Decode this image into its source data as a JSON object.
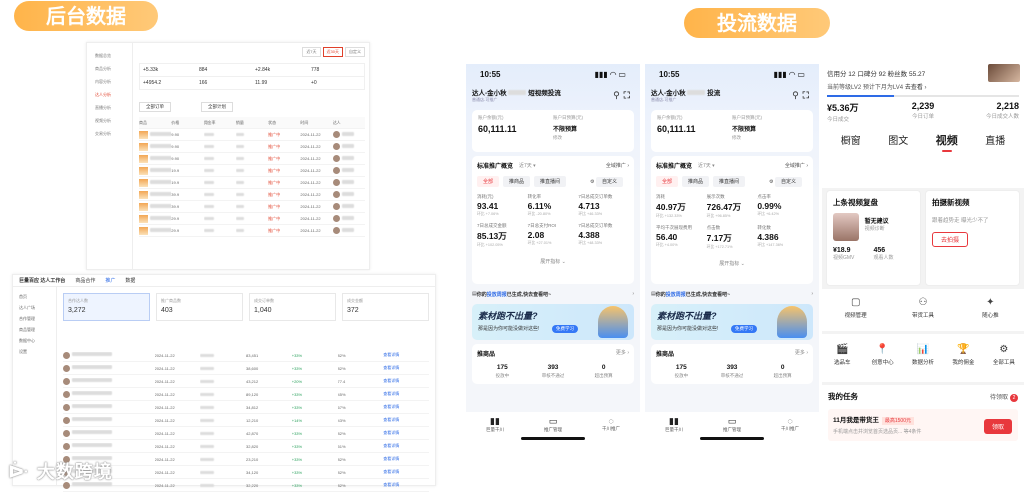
{
  "labels": {
    "backend": "后台数据",
    "ads": "投流数据"
  },
  "backend1": {
    "side_items": [
      "数据总览",
      "商品分析",
      "内容分析",
      "达人分析",
      "直播分析",
      "视频分析",
      "交易分析"
    ],
    "tabs": [
      "近7天",
      "近30天",
      "自定义"
    ],
    "stats": [
      "+5.33k",
      "884",
      "+2.84k",
      "778",
      "+4954.2",
      "166",
      "11.99",
      "+0"
    ],
    "filter1": "全部订单",
    "filter2": "全部计划",
    "headers": [
      "商品",
      "价格",
      "佣金率",
      "销量",
      "状态",
      "时间",
      "达人"
    ],
    "rows": [
      {
        "price": "9.90",
        "status": "推广中",
        "date": "2024-11-22"
      },
      {
        "price": "9.90",
        "status": "推广中",
        "date": "2024-11-22"
      },
      {
        "price": "9.90",
        "status": "推广中",
        "date": "2024-11-22"
      },
      {
        "price": "19.9",
        "status": "推广中",
        "date": "2024-11-22"
      },
      {
        "price": "19.9",
        "status": "推广中",
        "date": "2024-11-22"
      },
      {
        "price": "39.9",
        "status": "推广中",
        "date": "2024-11-22"
      },
      {
        "price": "39.9",
        "status": "推广中",
        "date": "2024-11-22"
      },
      {
        "price": "29.9",
        "status": "推广中",
        "date": "2024-11-22"
      },
      {
        "price": "29.9",
        "status": "推广中",
        "date": "2024-11-22"
      }
    ]
  },
  "backend2": {
    "logo": "巨量百应 达人工作台",
    "top_tabs": [
      "商品合作",
      "推广",
      "数据"
    ],
    "side_items": [
      "首页",
      "达人广场",
      "合作管理",
      "商品管理",
      "数据中心",
      "设置"
    ],
    "cards": [
      {
        "label": "合作达人数",
        "value": "3,272"
      },
      {
        "label": "推广商品数",
        "value": "403"
      },
      {
        "label": "成交订单数",
        "value": "1,040"
      },
      {
        "label": "成交金额",
        "value": "372"
      }
    ],
    "rows": [
      {
        "d": "2024-11-22",
        "v": "83,451",
        "p": "+33%",
        "s": "82%"
      },
      {
        "d": "2024-11-22",
        "v": "38,600",
        "p": "+33%",
        "s": "82%"
      },
      {
        "d": "2024-11-22",
        "v": "43,212",
        "p": "+20%",
        "s": "77.4"
      },
      {
        "d": "2024-11-22",
        "v": "89,120",
        "p": "+33%",
        "s": "45%"
      },
      {
        "d": "2024-11-22",
        "v": "34,812",
        "p": "+33%",
        "s": "67%"
      },
      {
        "d": "2024-11-22",
        "v": "12,210",
        "p": "+14%",
        "s": "43%"
      },
      {
        "d": "2024-11-22",
        "v": "42,870",
        "p": "+33%",
        "s": "82%"
      },
      {
        "d": "2024-11-22",
        "v": "32,820",
        "p": "+33%",
        "s": "51%"
      },
      {
        "d": "2024-11-22",
        "v": "23,210",
        "p": "+33%",
        "s": "82%"
      },
      {
        "d": "2024-11-22",
        "v": "34,120",
        "p": "+33%",
        "s": "82%"
      },
      {
        "d": "2024-11-22",
        "v": "32,220",
        "p": "+33%",
        "s": "82%"
      }
    ],
    "link": "查看详情"
  },
  "phones": {
    "time": "10:55",
    "title1": "达人-金小秋",
    "title1b": "短视频投流",
    "title2": "达人-金小秋",
    "title2b": "投流",
    "subtitle": "普通店-可推广",
    "balance_label": "账户余额(元)",
    "balance": "60,111.11",
    "budget_label": "账户日预算(元)",
    "budget_value": "不限预算",
    "budget_edit": "修改",
    "overview_title": "标准推广概览",
    "period": "近7天",
    "all_ads": "全域推广",
    "chips": [
      "全部",
      "推商品",
      "推直播间"
    ],
    "customize": "自定义",
    "expand": "展开指标",
    "notice_a": "你的",
    "notice_b": "投放周报",
    "notice_c": "已生成,快去查看吧~",
    "banner_title": "素材跑不出量?",
    "banner_sub": "那是因为你可能没做对这些!",
    "banner_btn": "免费学习",
    "rec_title": "推商品",
    "rec_more": "更多",
    "tab_labels": [
      "巨量千川",
      "推广管理",
      "千川推广"
    ]
  },
  "phone1": {
    "metrics": [
      {
        "l": "消耗(元)",
        "v": "93.41",
        "c": "环比 +7.06%"
      },
      {
        "l": "转化率",
        "v": "6.11%",
        "c": "环比 -20.80%"
      },
      {
        "l": "7日总成交订单数",
        "v": "4.713",
        "c": "环比 +46.33%"
      },
      {
        "l": "7日总成交金额",
        "v": "85.13万",
        "c": "环比 +102.05%"
      },
      {
        "l": "7日总支付ROI",
        "v": "2.08",
        "c": "环比 +27.01%"
      },
      {
        "l": "7日总成交订单数",
        "v": "4.388",
        "c": "环比 +48.33%"
      }
    ],
    "rec": [
      {
        "v": "175",
        "l": "投放中"
      },
      {
        "v": "393",
        "l": "审核不通过"
      },
      {
        "v": "0",
        "l": "超出预算"
      }
    ]
  },
  "phone2": {
    "metrics": [
      {
        "l": "消耗",
        "v": "40.97万",
        "c": "环比 +132.33%"
      },
      {
        "l": "展示次数",
        "v": "726.47万",
        "c": "环比 +96.85%"
      },
      {
        "l": "点击率",
        "v": "0.99%",
        "c": "环比 +6.42%"
      },
      {
        "l": "平均千次展现费用",
        "v": "56.40",
        "c": "环比 +4.00%"
      },
      {
        "l": "点击数",
        "v": "7.17万",
        "c": "环比 +172.71%"
      },
      {
        "l": "转化数",
        "v": "4.386",
        "c": "环比 +147.36%"
      }
    ],
    "rec": [
      {
        "v": "175",
        "l": "投放中"
      },
      {
        "v": "393",
        "l": "审核不通过"
      },
      {
        "v": "0",
        "l": "超出预算"
      }
    ]
  },
  "app": {
    "line1": "信用分 12  口碑分 92  粉丝数 55.27",
    "line2a": "当前等级LV2 预计下月为LV4",
    "line2b": "去查看",
    "level_progress": 0.35,
    "stats": [
      {
        "v": "¥5.36万",
        "l": "今日成交"
      },
      {
        "v": "2,239",
        "l": "今日订单"
      },
      {
        "v": "2,218",
        "l": "今日成交人数"
      }
    ],
    "tabs": [
      "橱窗",
      "图文",
      "视频",
      "直播"
    ],
    "active_tab": "视频",
    "review_title": "上条视频复盘",
    "review_name": "暂无建议",
    "review_sub": "视频诊断",
    "gmv_v": "¥18.9",
    "gmv_l": "视频GMV",
    "viewers_v": "456",
    "viewers_l": "观看人数",
    "shoot_title": "拍摄新视频",
    "shoot_desc": "跟着趋势走 曝光少不了",
    "shoot_btn": "去拍摄",
    "tools": [
      {
        "i": "▢",
        "l": "视频管理"
      },
      {
        "i": "⚇",
        "l": "带货工具"
      },
      {
        "i": "✦",
        "l": "随心推"
      }
    ],
    "tools2": [
      {
        "i": "🎬",
        "l": "选品车"
      },
      {
        "i": "📍",
        "l": "创意中心"
      },
      {
        "i": "📊",
        "l": "数据分析"
      },
      {
        "i": "🏆",
        "l": "我的佣金"
      },
      {
        "i": "⚙",
        "l": "全部工具"
      }
    ],
    "task_title": "我的任务",
    "task_link": "待领取",
    "task_badge": "2",
    "task_name": "11月我是带货王",
    "task_tag": "最高1500元",
    "task_desc": "手机端点击并浏览首页选品页...",
    "task_progress": "等4条件",
    "task_btn": "领取"
  },
  "watermark": "大数跨境"
}
